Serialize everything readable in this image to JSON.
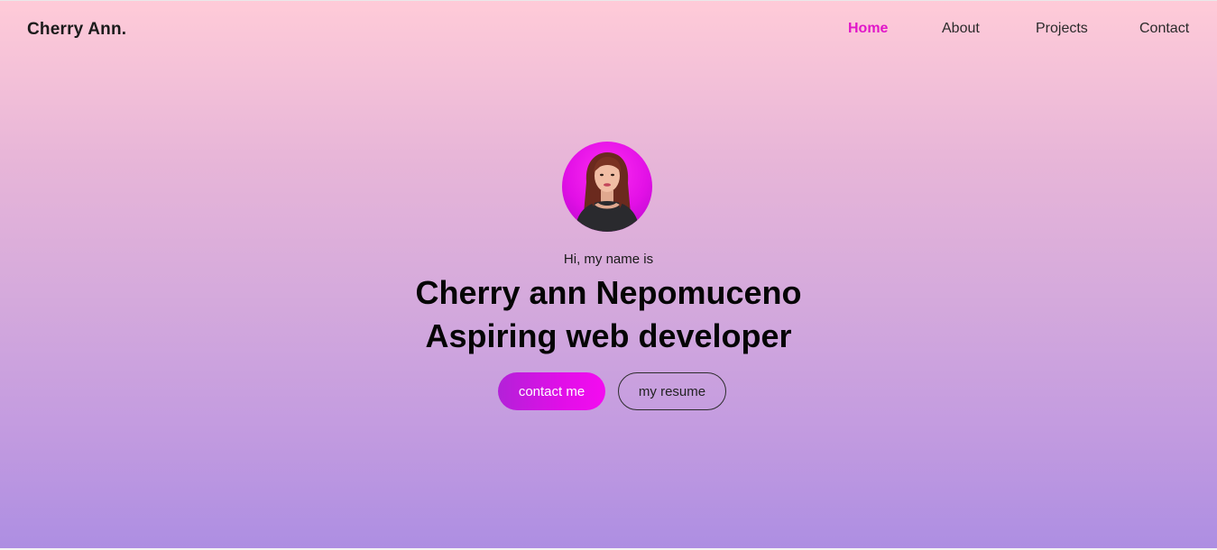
{
  "header": {
    "brand": "Cherry Ann.",
    "nav": [
      {
        "label": "Home",
        "active": true
      },
      {
        "label": "About",
        "active": false
      },
      {
        "label": "Projects",
        "active": false
      },
      {
        "label": "Contact",
        "active": false
      }
    ]
  },
  "hero": {
    "avatar_icon": "profile-photo",
    "greeting": "Hi, my name is",
    "name": "Cherry ann Nepomuceno",
    "role": "Aspiring web developer",
    "primary_button": "contact me",
    "secondary_button": "my resume"
  },
  "colors": {
    "accent": "#e116c9",
    "gradient_top": "#ffcbd8",
    "gradient_bottom": "#ad8ee2"
  }
}
